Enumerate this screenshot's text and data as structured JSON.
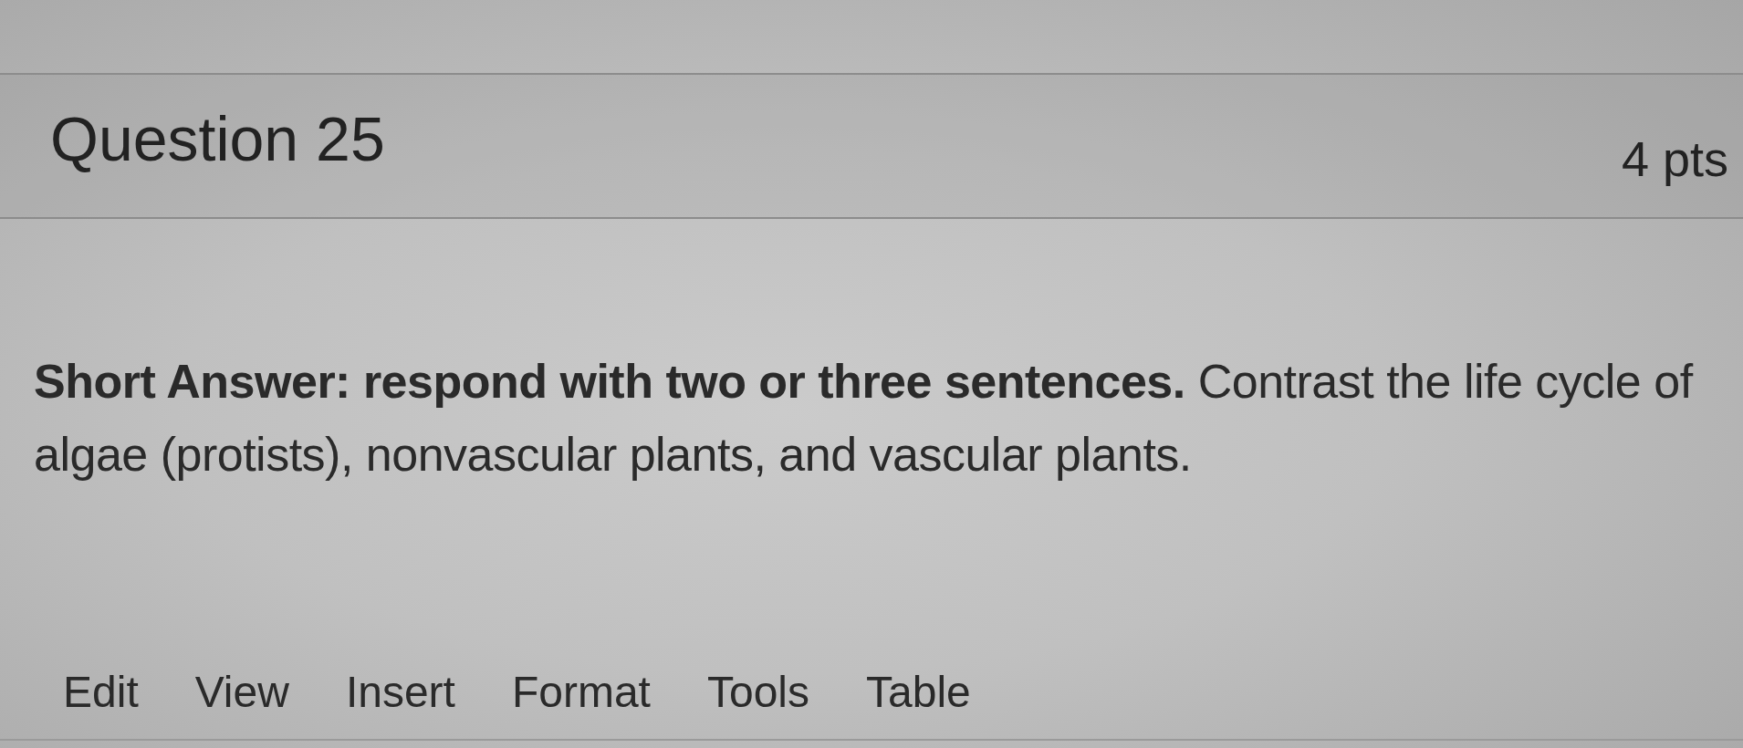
{
  "question": {
    "title": "Question 25",
    "points": "4 pts"
  },
  "prompt": "**Short Answer: respond with two or three sentences.** Contrast the life cycle of algae (protists), nonvascular plants, and vascular plants.",
  "menu_bar": {
    "items": [
      "Edit",
      "View",
      "Insert",
      "Format",
      "Tools",
      "Table"
    ]
  }
}
